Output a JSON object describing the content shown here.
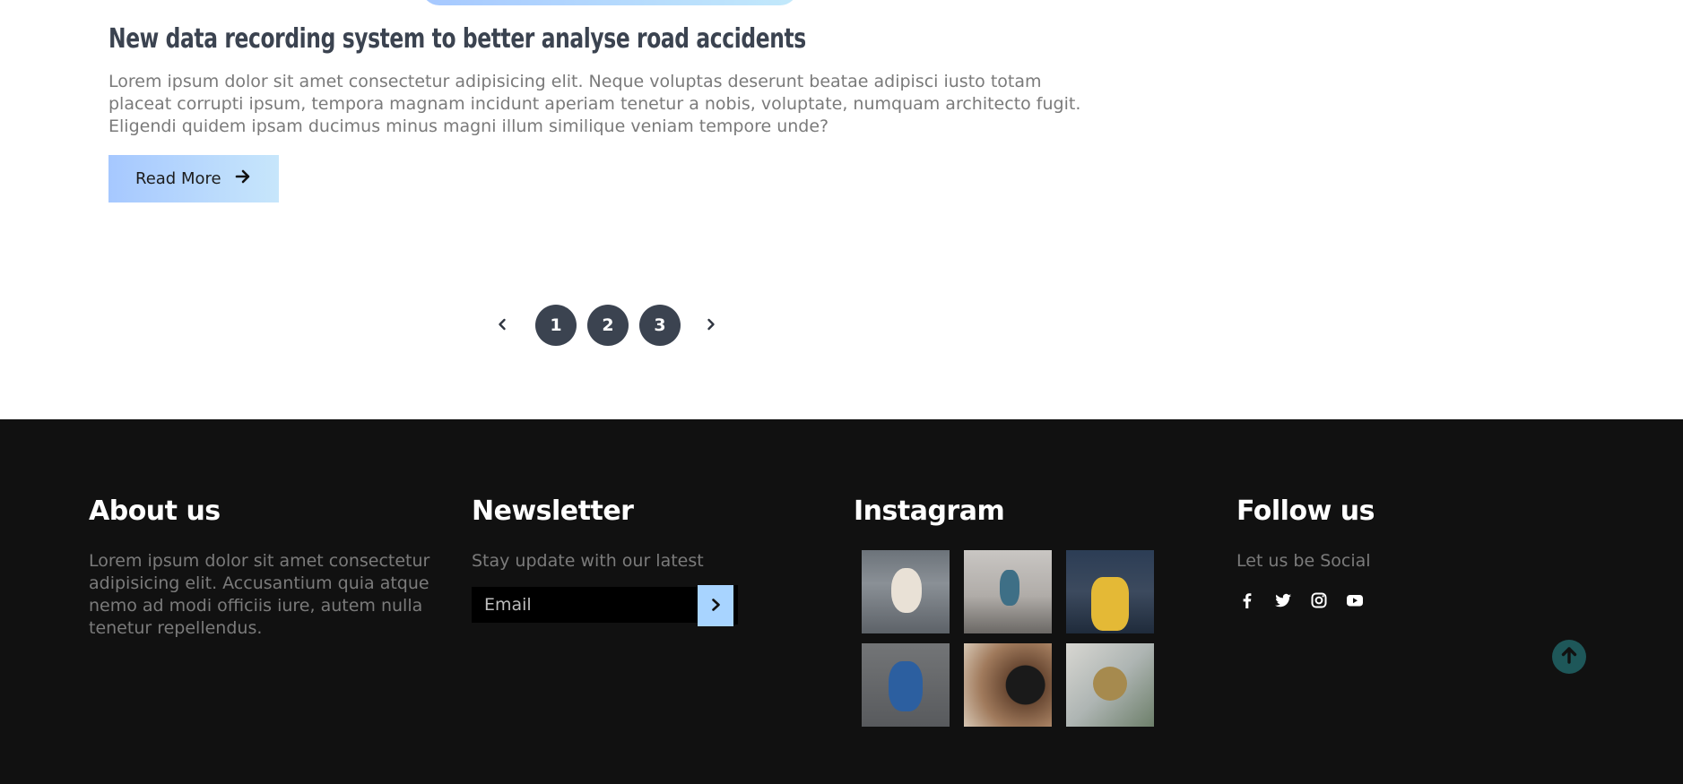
{
  "post": {
    "title": "New data recording system to better analyse road accidents",
    "excerpt": "Lorem ipsum dolor sit amet consectetur adipisicing elit. Neque voluptas deserunt beatae adipisci iusto totam placeat corrupti ipsum, tempora magnam incidunt aperiam tenetur a nobis, voluptate, numquam architecto fugit. Eligendi quidem ipsam ducimus minus magni illum similique veniam tempore unde?",
    "read_more_label": "Read More"
  },
  "pagination": {
    "pages": [
      "1",
      "2",
      "3"
    ]
  },
  "footer": {
    "about": {
      "title": "About us",
      "text": "Lorem ipsum dolor sit amet consectetur adipisicing elit. Accusantium quia atque nemo ad modi officiis iure, autem nulla tenetur repellendus."
    },
    "newsletter": {
      "title": "Newsletter",
      "text": "Stay update with our latest",
      "email_placeholder": "Email"
    },
    "instagram": {
      "title": "Instagram",
      "images": [
        "dog",
        "woman-sitting",
        "man-yellow-sweater",
        "blue-car",
        "camera",
        "compass"
      ]
    },
    "follow": {
      "title": "Follow us",
      "text": "Let us be Social",
      "icons": [
        "facebook-icon",
        "twitter-icon",
        "instagram-icon",
        "youtube-icon"
      ]
    }
  },
  "colors": {
    "accent_gradient_start": "#a6c8ff",
    "accent_gradient_end": "#c2e9fb",
    "pagination_bg": "#3b4350",
    "footer_bg": "#111111",
    "back_to_top": "#1e5759"
  }
}
